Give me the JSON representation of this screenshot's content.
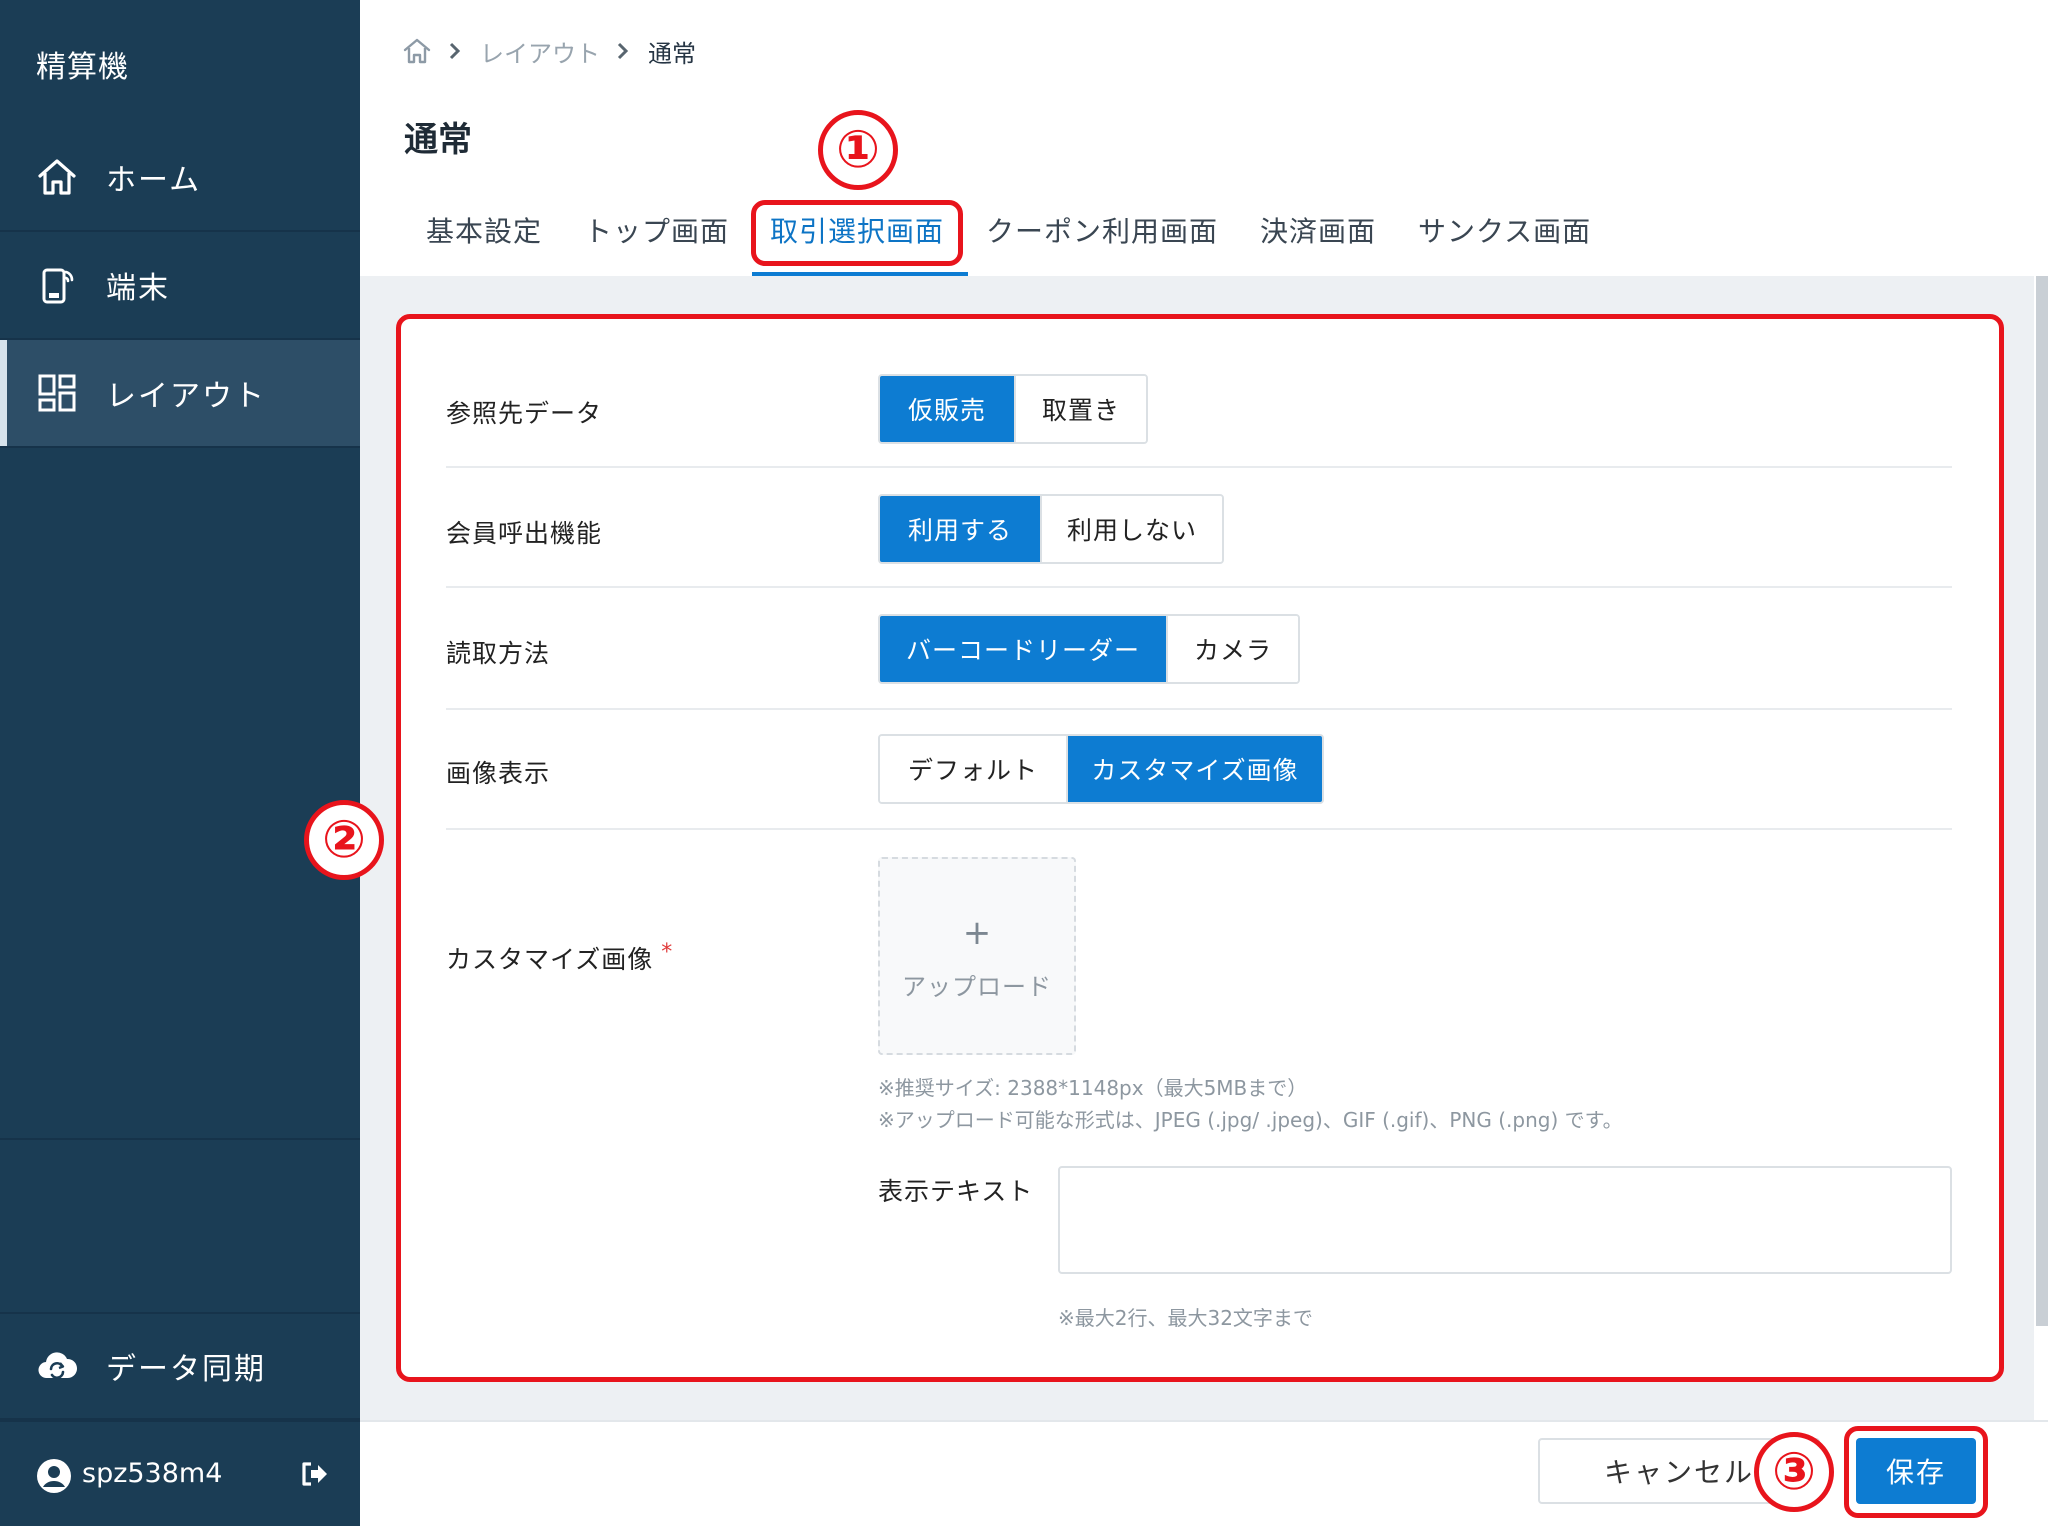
{
  "sidebar": {
    "title": "精算機",
    "items": [
      {
        "label": "ホーム",
        "icon": "home-icon"
      },
      {
        "label": "端末",
        "icon": "device-icon"
      },
      {
        "label": "レイアウト",
        "icon": "layout-icon"
      }
    ],
    "sync": {
      "label": "データ同期",
      "icon": "cloud-sync-icon"
    },
    "user": {
      "name": "spz538m4",
      "icon": "user-circle-icon",
      "logout_icon": "logout-icon"
    }
  },
  "breadcrumb": {
    "items": [
      "レイアウト",
      "通常"
    ]
  },
  "page": {
    "title": "通常"
  },
  "tabs": [
    {
      "label": "基本設定"
    },
    {
      "label": "トップ画面"
    },
    {
      "label": "取引選択画面",
      "active": true
    },
    {
      "label": "クーポン利用画面"
    },
    {
      "label": "決済画面"
    },
    {
      "label": "サンクス画面"
    }
  ],
  "form": {
    "reference": {
      "label": "参照先データ",
      "options": [
        "仮販売",
        "取置き"
      ],
      "selected": "仮販売"
    },
    "member": {
      "label": "会員呼出機能",
      "options": [
        "利用する",
        "利用しない"
      ],
      "selected": "利用する"
    },
    "reading": {
      "label": "読取方法",
      "options": [
        "バーコードリーダー",
        "カメラ"
      ],
      "selected": "バーコードリーダー"
    },
    "image_display": {
      "label": "画像表示",
      "options": [
        "デフォルト",
        "カスタマイズ画像"
      ],
      "selected": "カスタマイズ画像"
    },
    "custom_image": {
      "label": "カスタマイズ画像",
      "required_mark": "*",
      "upload_plus": "+",
      "upload_label": "アップロード",
      "note_size": "※推奨サイズ: 2388*1148px（最大5MBまで）",
      "note_format": "※アップロード可能な形式は、JPEG (.jpg/ .jpeg)、GIF (.gif)、PNG (.png) です。"
    },
    "display_text": {
      "label": "表示テキスト",
      "value": "",
      "note": "※最大2行、最大32文字まで"
    }
  },
  "annotations": {
    "one": "①",
    "two": "②",
    "three": "③",
    "color": "#e8141c"
  },
  "footer": {
    "cancel_label": "キャンセル",
    "save_label": "保存"
  },
  "colors": {
    "sidebar": "#1b3d55",
    "accent": "#0d7cd2",
    "content_bg": "#edf0f3"
  }
}
